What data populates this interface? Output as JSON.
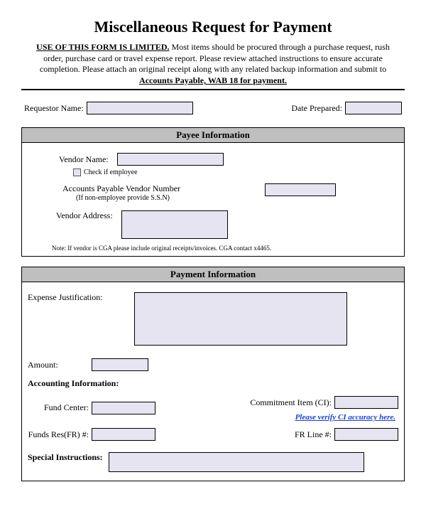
{
  "title": "Miscellaneous Request for Payment",
  "intro": {
    "lead": "USE OF THIS FORM IS LIMITED.",
    "body": " Most items should be procured through a purchase request, rush order, purchase card or travel expense report. Please review attached instructions to ensure accurate completion. Please attach an original receipt along with any related backup information and submit to ",
    "tail": "Accounts Payable, WAB 18 for payment."
  },
  "top": {
    "requestor_label": "Requestor Name:",
    "date_label": "Date Prepared:"
  },
  "payee": {
    "header": "Payee Information",
    "vendor_name_label": "Vendor Name:",
    "check_employee_label": "Check if employee",
    "apvn_label": "Accounts Payable Vendor Number",
    "apvn_sub": "(If non-employee provide S.S.N)",
    "vendor_address_label": "Vendor Address:",
    "note": "Note: If vendor is CGA please include original receipts/invoices. CGA contact x4465."
  },
  "payment": {
    "header": "Payment Information",
    "expense_label": "Expense Justification:",
    "amount_label": "Amount:",
    "accounting_label": "Accounting Information:",
    "fund_center_label": "Fund Center:",
    "commitment_label": "Commitment Item (CI):",
    "verify_link": "Please verify CI accuracy here.",
    "funds_res_label": "Funds Res(FR) #:",
    "fr_line_label": "FR Line #:",
    "special_label": "Special Instructions:"
  }
}
